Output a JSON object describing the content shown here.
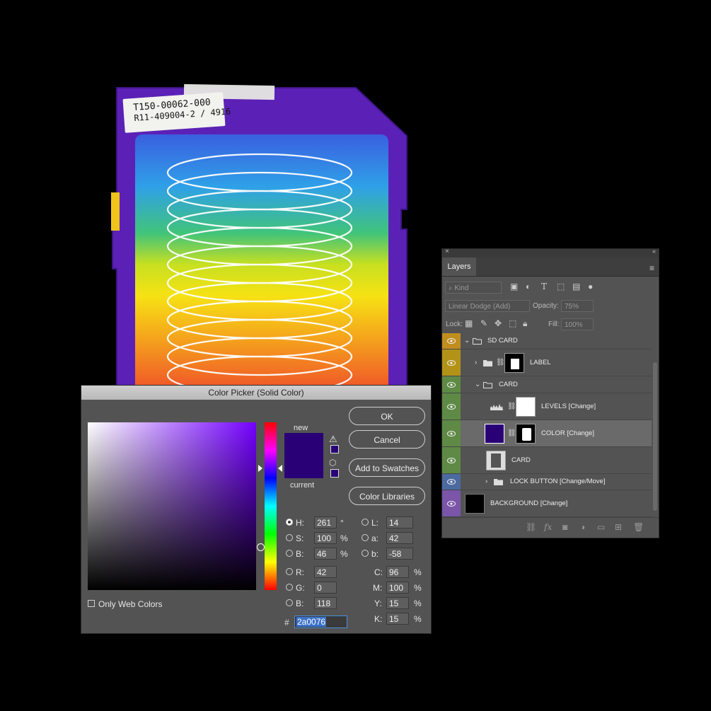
{
  "card_label": {
    "line1": "T150-00062-000",
    "line2": "R11-409004-2 / 4916"
  },
  "color_picker": {
    "title": "Color Picker (Solid Color)",
    "new_label": "new",
    "current_label": "current",
    "new_color": "#2a0076",
    "current_color": "#2a0076",
    "buttons": {
      "ok": "OK",
      "cancel": "Cancel",
      "add_to_swatches": "Add to Swatches",
      "color_libraries": "Color Libraries"
    },
    "fields": {
      "H": {
        "label": "H:",
        "value": "261",
        "unit": "°"
      },
      "S": {
        "label": "S:",
        "value": "100",
        "unit": "%"
      },
      "Bv": {
        "label": "B:",
        "value": "46",
        "unit": "%"
      },
      "R": {
        "label": "R:",
        "value": "42"
      },
      "G": {
        "label": "G:",
        "value": "0"
      },
      "B": {
        "label": "B:",
        "value": "118"
      },
      "L": {
        "label": "L:",
        "value": "14"
      },
      "a": {
        "label": "a:",
        "value": "42"
      },
      "b": {
        "label": "b:",
        "value": "-58"
      },
      "C": {
        "label": "C:",
        "value": "96",
        "unit": "%"
      },
      "M": {
        "label": "M:",
        "value": "100",
        "unit": "%"
      },
      "Y": {
        "label": "Y:",
        "value": "15",
        "unit": "%"
      },
      "K": {
        "label": "K:",
        "value": "15",
        "unit": "%"
      }
    },
    "hex_symbol": "#",
    "hex_value": "2a0076",
    "only_web_colors": "Only Web Colors",
    "hue_gradient_top": "#7300ff"
  },
  "layers_panel": {
    "tab": "Layers",
    "filter_kind": "Kind",
    "blend_mode": "Linear Dodge (Add)",
    "opacity_label": "Opacity:",
    "opacity_value": "75%",
    "lock_label": "Lock:",
    "fill_label": "Fill:",
    "fill_value": "100%",
    "layers": [
      {
        "name": "SD CARD",
        "color": "#c08d1f"
      },
      {
        "name": "LABEL",
        "color": "#b39317"
      },
      {
        "name": "CARD",
        "color": "#5e8a45"
      },
      {
        "name": "LEVELS [Change]",
        "color": "#5e8a45"
      },
      {
        "name": "COLOR [Change]",
        "color": "#5e8a45"
      },
      {
        "name": "CARD",
        "color": "#5e8a45"
      },
      {
        "name": "LOCK BUTTON [Change/Move]",
        "color": "#4b6aa0"
      },
      {
        "name": "BACKGROUND [Change]",
        "color": "#7a55a8"
      }
    ]
  }
}
